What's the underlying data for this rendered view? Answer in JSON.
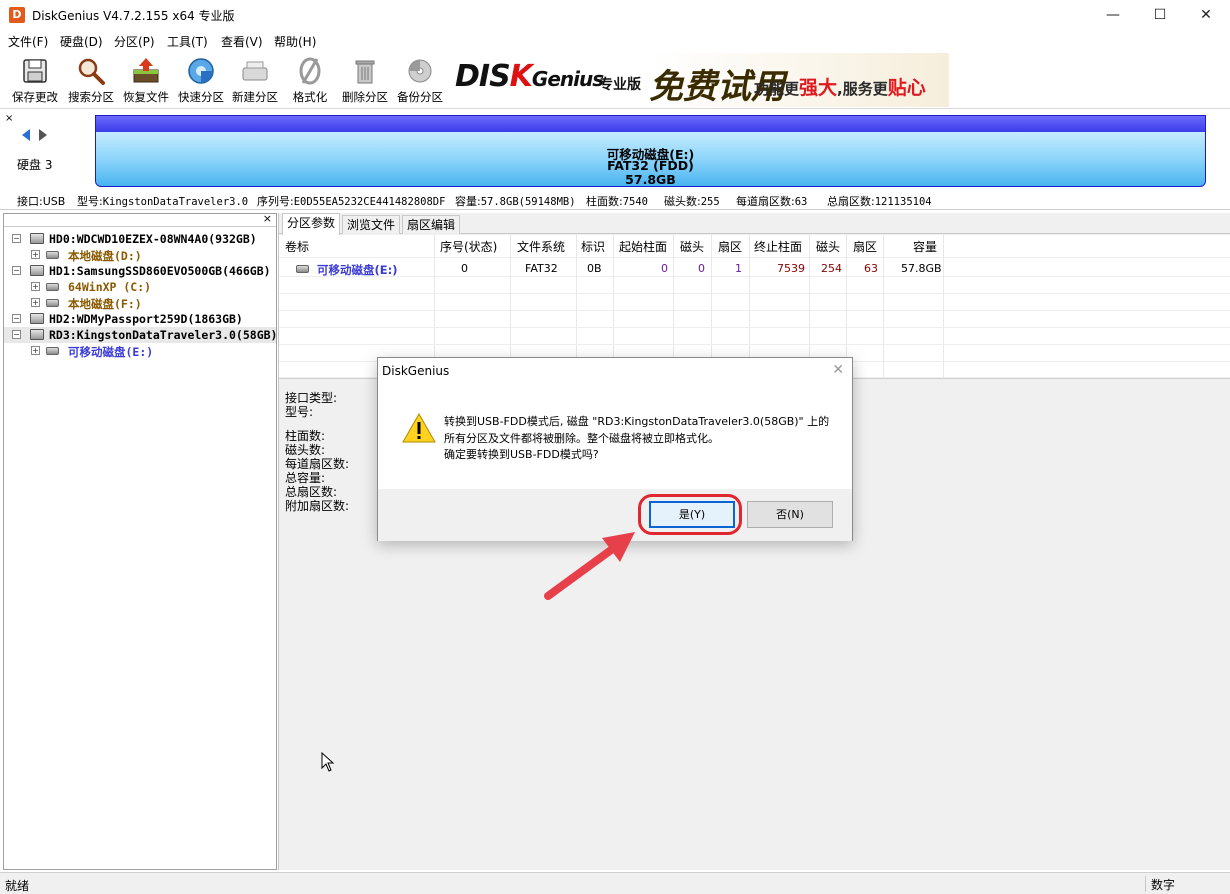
{
  "window": {
    "title": "DiskGenius V4.7.2.155 x64 专业版",
    "app_icon_glyph": "D",
    "minimize": "—",
    "maximize": "☐",
    "close": "✕"
  },
  "menu": [
    "文件(F)",
    "硬盘(D)",
    "分区(P)",
    "工具(T)",
    "查看(V)",
    "帮助(H)"
  ],
  "toolbar": [
    {
      "label": "保存更改",
      "icon": "save-icon"
    },
    {
      "label": "搜索分区",
      "icon": "search-icon"
    },
    {
      "label": "恢复文件",
      "icon": "recover-icon"
    },
    {
      "label": "快速分区",
      "icon": "quick-partition-icon"
    },
    {
      "label": "新建分区",
      "icon": "new-partition-icon"
    },
    {
      "label": "格式化",
      "icon": "format-icon"
    },
    {
      "label": "删除分区",
      "icon": "delete-icon"
    },
    {
      "label": "备份分区",
      "icon": "backup-icon"
    }
  ],
  "banner": {
    "logo_pre": "DIS",
    "logo_k": "K",
    "logo_post": "Genius",
    "edition": "专业版",
    "free_trial": "免费试用",
    "slogan_a": "功能更",
    "slogan_b": "强大",
    "slogan_c": ",服务更",
    "slogan_d": "贴心"
  },
  "disk_panel": {
    "close": "×",
    "disk_label": "硬盘 3",
    "partition_name": "可移动磁盘(E:)",
    "partition_fs": "FAT32 (FDD)",
    "partition_size": "57.8GB"
  },
  "disk_info": {
    "interface": "接口:USB",
    "model_label": "型号:",
    "model": "KingstonDataTraveler3.0",
    "serial_label": "序列号:",
    "serial": "E0D55EA5232CE441482808DF",
    "capacity_label": "容量:",
    "capacity": "57.8GB(59148MB)",
    "cylinders_label": "柱面数:",
    "cylinders": "7540",
    "heads_label": "磁头数:",
    "heads": "255",
    "spt_label": "每道扇区数:",
    "spt": "63",
    "total_sectors_label": "总扇区数:",
    "total_sectors": "121135104"
  },
  "tree": {
    "close": "×",
    "rows": [
      {
        "text": "HD0:WDCWD10EZEX-08WN4A0(932GB)",
        "kind": "disk",
        "color": "#000000"
      },
      {
        "text": "本地磁盘(D:)",
        "kind": "part",
        "color": "#8b5a00"
      },
      {
        "text": "HD1:SamsungSSD860EVO500GB(466GB)",
        "kind": "disk",
        "color": "#000000"
      },
      {
        "text": "64WinXP (C:)",
        "kind": "part",
        "color": "#8b5a00"
      },
      {
        "text": "本地磁盘(F:)",
        "kind": "part",
        "color": "#8b5a00"
      },
      {
        "text": "HD2:WDMyPassport259D(1863GB)",
        "kind": "disk",
        "color": "#000000"
      },
      {
        "text": "RD3:KingstonDataTraveler3.0(58GB)",
        "kind": "disk",
        "color": "#000000"
      },
      {
        "text": "可移动磁盘(E:)",
        "kind": "part",
        "color": "#3b3bd6"
      }
    ]
  },
  "tabs": [
    "分区参数",
    "浏览文件",
    "扇区编辑"
  ],
  "table": {
    "headers": [
      "卷标",
      "序号(状态)",
      "文件系统",
      "标识",
      "起始柱面",
      "磁头",
      "扇区",
      "终止柱面",
      "磁头",
      "扇区",
      "容量"
    ],
    "row": {
      "volume": "可移动磁盘(E:)",
      "index": "0",
      "fs": "FAT32",
      "id": "0B",
      "start_cyl": "0",
      "start_head": "0",
      "start_sector": "1",
      "end_cyl": "7539",
      "end_head": "254",
      "end_sector": "63",
      "capacity": "57.8GB"
    }
  },
  "info_labels": [
    "接口类型:",
    "型号:",
    "柱面数:",
    "磁头数:",
    "每道扇区数:",
    "总容量:",
    "总扇区数:",
    "附加扇区数:"
  ],
  "dialog": {
    "title": "DiskGenius",
    "close": "✕",
    "message_line1": "转换到USB-FDD模式后, 磁盘 \"RD3:KingstonDataTraveler3.0(58GB)\" 上的",
    "message_line2": "所有分区及文件都将被删除。整个磁盘将被立即格式化。",
    "message_line3": "确定要转换到USB-FDD模式吗?",
    "yes": "是(Y)",
    "no": "否(N)",
    "highlight_color": "#e0262e"
  },
  "status": {
    "left": "就绪",
    "right": "数字"
  },
  "colors": {
    "partition_bar_top": "#3b3be8",
    "partition_bar": "#8fd6fb",
    "start_value_color": "#6a1b9a",
    "end_value_color": "#8b0000"
  }
}
